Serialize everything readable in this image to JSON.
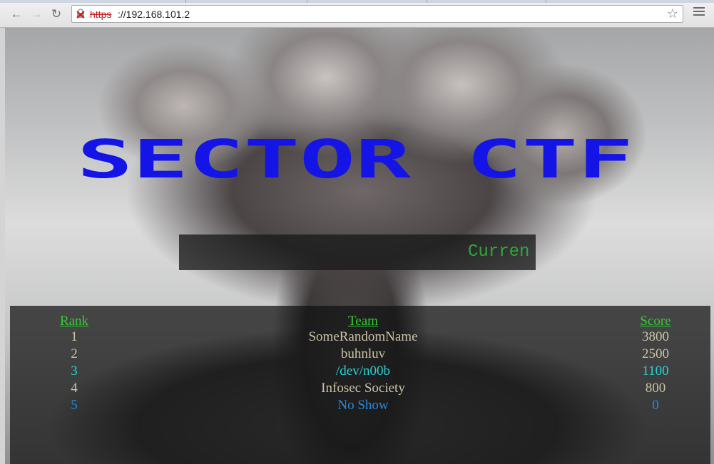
{
  "browser": {
    "url_scheme": "https",
    "url_rest": "://192.168.101.2",
    "back_icon": "arrow-left-icon",
    "forward_icon": "arrow-right-icon",
    "reload_icon": "reload-icon",
    "star_icon": "star-icon",
    "menu_icon": "hamburger-menu-icon"
  },
  "page": {
    "logo_text": "SECTOR CTF",
    "logo_color": "#1414e6",
    "marquee": "Curren",
    "marquee_color": "#2fa83a"
  },
  "scoreboard": {
    "headers": {
      "rank": "Rank",
      "team": "Team",
      "score": "Score"
    },
    "header_color": "#32cd32",
    "rows": [
      {
        "rank": "1",
        "team": "SomeRandomName",
        "score": "3800",
        "color": "#c9c3a6"
      },
      {
        "rank": "2",
        "team": "buhnluv",
        "score": "2500",
        "color": "#c9c3a6"
      },
      {
        "rank": "3",
        "team": "/dev/n00b",
        "score": "1100",
        "color": "#26d3d6"
      },
      {
        "rank": "4",
        "team": "Infosec Society",
        "score": "800",
        "color": "#c9c3a6"
      },
      {
        "rank": "5",
        "team": "No Show",
        "score": "0",
        "color": "#2a88d8"
      }
    ]
  }
}
